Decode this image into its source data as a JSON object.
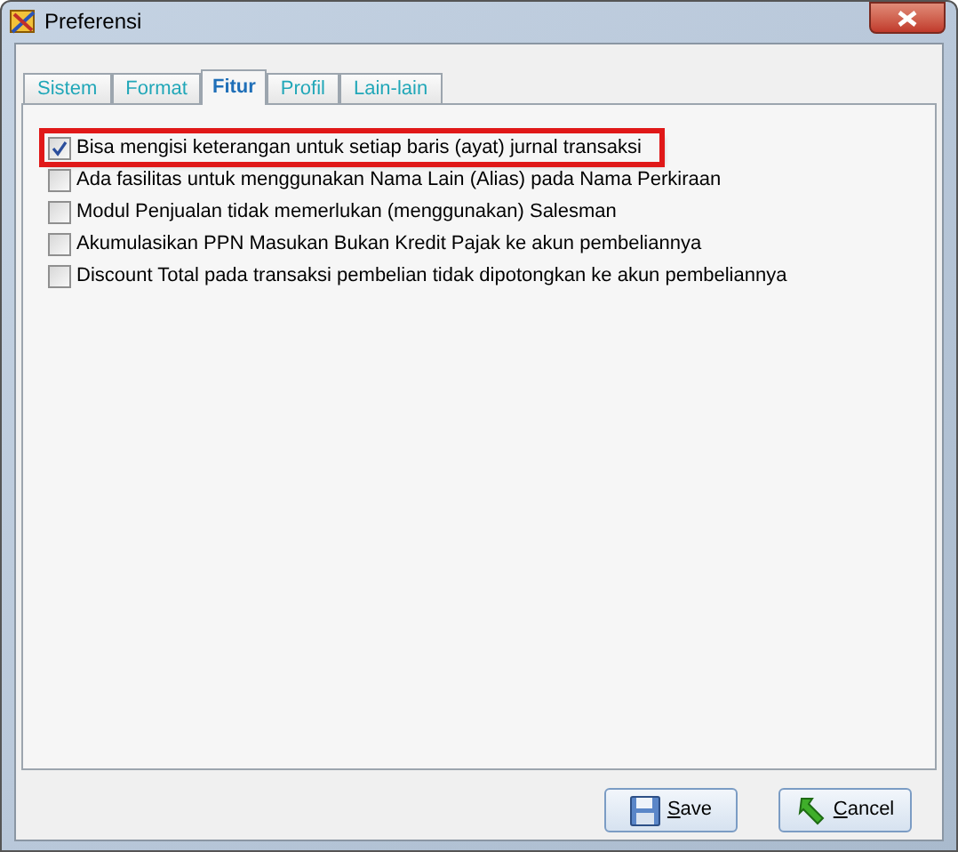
{
  "window": {
    "title": "Preferensi"
  },
  "tabs": [
    {
      "label": "Sistem",
      "selected": false
    },
    {
      "label": "Format",
      "selected": false
    },
    {
      "label": "Fitur",
      "selected": true
    },
    {
      "label": "Profil",
      "selected": false
    },
    {
      "label": "Lain-lain",
      "selected": false
    }
  ],
  "options": [
    {
      "label": "Bisa mengisi keterangan untuk setiap baris (ayat) jurnal transaksi",
      "checked": true,
      "highlighted": true
    },
    {
      "label": "Ada fasilitas untuk menggunakan Nama Lain (Alias) pada Nama Perkiraan",
      "checked": false,
      "highlighted": false
    },
    {
      "label": "Modul Penjualan tidak memerlukan (menggunakan) Salesman",
      "checked": false,
      "highlighted": false
    },
    {
      "label": "Akumulasikan PPN Masukan Bukan Kredit Pajak ke akun pembeliannya",
      "checked": false,
      "highlighted": false
    },
    {
      "label": "Discount Total pada transaksi pembelian tidak dipotongkan ke akun pembeliannya",
      "checked": false,
      "highlighted": false
    }
  ],
  "buttons": [
    {
      "kind": "save",
      "label": "Save"
    },
    {
      "kind": "cancel",
      "label": "Cancel"
    }
  ]
}
